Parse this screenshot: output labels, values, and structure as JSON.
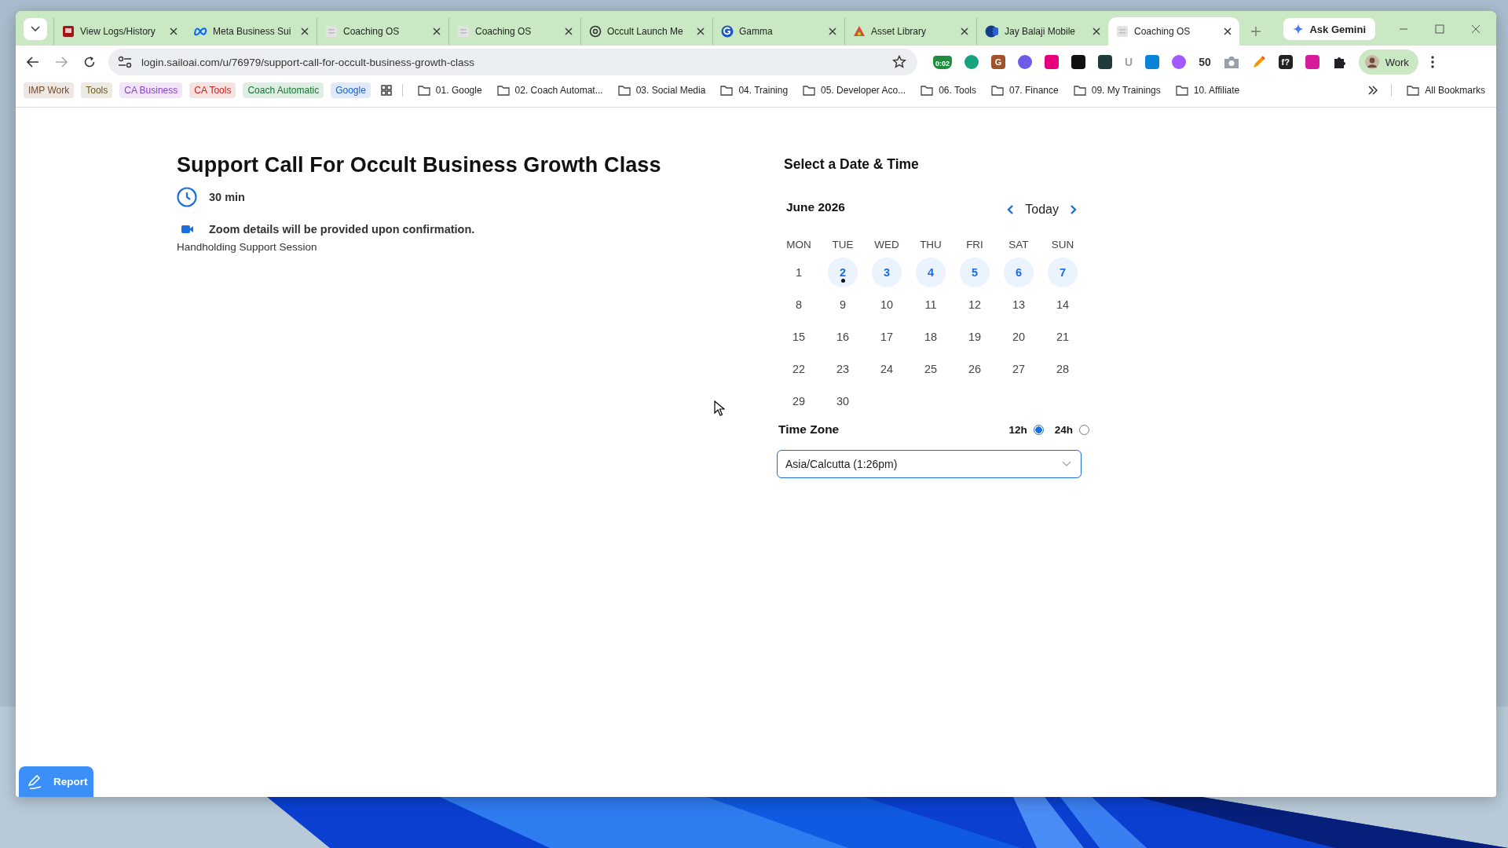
{
  "browser": {
    "tabs": [
      {
        "title": "View Logs/History",
        "kind": "log",
        "selected": false
      },
      {
        "title": "Meta Business Sui",
        "kind": "meta",
        "selected": false
      },
      {
        "title": "Coaching OS",
        "kind": "page",
        "selected": false
      },
      {
        "title": "Coaching OS",
        "kind": "page",
        "selected": false
      },
      {
        "title": "Occult Launch Me",
        "kind": "knot",
        "selected": false
      },
      {
        "title": "Gamma",
        "kind": "gamma",
        "selected": false
      },
      {
        "title": "Asset Library",
        "kind": "asset",
        "selected": false
      },
      {
        "title": "Jay Balaji Mobile",
        "kind": "jb",
        "selected": false
      },
      {
        "title": "Coaching OS",
        "kind": "page",
        "selected": true
      }
    ],
    "gemini": "Ask Gemini",
    "url": "login.sailoai.com/u/76979/support-call-for-occult-business-growth-class",
    "extensions": [
      {
        "kind": "badge",
        "color": "#1e8e3e",
        "text": "0:02"
      },
      {
        "kind": "circle",
        "color": "#15a37f"
      },
      {
        "kind": "square",
        "color": "#a0522d",
        "text": "G"
      },
      {
        "kind": "circle",
        "color": "#6c5ce7"
      },
      {
        "kind": "square",
        "color": "#e6007e"
      },
      {
        "kind": "square",
        "color": "#111111"
      },
      {
        "kind": "square",
        "color": "#1f3b3b"
      },
      {
        "kind": "glyph",
        "color": "#9aa0a6",
        "text": "U"
      },
      {
        "kind": "square",
        "color": "#0a84d8"
      },
      {
        "kind": "circle",
        "color": "#a259ff"
      },
      {
        "kind": "glyph",
        "color": "#333333",
        "text": "50"
      },
      {
        "kind": "camera",
        "color": "#9aa0a6"
      },
      {
        "kind": "pen",
        "color": "#f29900"
      },
      {
        "kind": "square",
        "color": "#222222",
        "text": "f?"
      },
      {
        "kind": "square",
        "color": "#d81b9b"
      },
      {
        "kind": "puzzle",
        "color": "#202124"
      }
    ],
    "profile": "Work",
    "bookmark_chips": [
      {
        "label": "IMP Work",
        "color": "#7a4a2a"
      },
      {
        "label": "Tools",
        "color": "#6b5a1e"
      },
      {
        "label": "CA Business",
        "color": "#8a3ec8"
      },
      {
        "label": "CA Tools",
        "color": "#c5221f"
      },
      {
        "label": "Coach Automatic",
        "color": "#137333"
      },
      {
        "label": "Google",
        "color": "#1a5fd0"
      }
    ],
    "bookmark_folders": [
      "01. Google",
      "02. Coach Automat...",
      "03. Social Media",
      "04. Training",
      "05. Developer Aco...",
      "06. Tools",
      "07. Finance",
      "09. My Trainings",
      "10. Affiliate"
    ],
    "all_bookmarks": "All Bookmarks"
  },
  "event": {
    "title": "Support Call For Occult Business Growth Class",
    "duration": "30 min",
    "location": "Zoom details will be provided upon confirmation.",
    "description": "Handholding Support Session"
  },
  "calendar": {
    "heading": "Select a Date & Time",
    "month": "June 2026",
    "today_label": "Today",
    "weekdays": [
      "MON",
      "TUE",
      "WED",
      "THU",
      "FRI",
      "SAT",
      "SUN"
    ],
    "days": [
      {
        "label": "1",
        "available": false,
        "today": false
      },
      {
        "label": "2",
        "available": true,
        "today": true
      },
      {
        "label": "3",
        "available": true,
        "today": false
      },
      {
        "label": "4",
        "available": true,
        "today": false
      },
      {
        "label": "5",
        "available": true,
        "today": false
      },
      {
        "label": "6",
        "available": true,
        "today": false
      },
      {
        "label": "7",
        "available": true,
        "today": false
      },
      {
        "label": "8",
        "available": false,
        "today": false
      },
      {
        "label": "9",
        "available": false,
        "today": false
      },
      {
        "label": "10",
        "available": false,
        "today": false
      },
      {
        "label": "11",
        "available": false,
        "today": false
      },
      {
        "label": "12",
        "available": false,
        "today": false
      },
      {
        "label": "13",
        "available": false,
        "today": false
      },
      {
        "label": "14",
        "available": false,
        "today": false
      },
      {
        "label": "15",
        "available": false,
        "today": false
      },
      {
        "label": "16",
        "available": false,
        "today": false
      },
      {
        "label": "17",
        "available": false,
        "today": false
      },
      {
        "label": "18",
        "available": false,
        "today": false
      },
      {
        "label": "19",
        "available": false,
        "today": false
      },
      {
        "label": "20",
        "available": false,
        "today": false
      },
      {
        "label": "21",
        "available": false,
        "today": false
      },
      {
        "label": "22",
        "available": false,
        "today": false
      },
      {
        "label": "23",
        "available": false,
        "today": false
      },
      {
        "label": "24",
        "available": false,
        "today": false
      },
      {
        "label": "25",
        "available": false,
        "today": false
      },
      {
        "label": "26",
        "available": false,
        "today": false
      },
      {
        "label": "27",
        "available": false,
        "today": false
      },
      {
        "label": "28",
        "available": false,
        "today": false
      },
      {
        "label": "29",
        "available": false,
        "today": false
      },
      {
        "label": "30",
        "available": false,
        "today": false
      }
    ],
    "timezone_label": "Time Zone",
    "formats": [
      {
        "label": "12h",
        "selected": true
      },
      {
        "label": "24h",
        "selected": false
      }
    ],
    "timezone": "Asia/Calcutta (1:26pm)"
  },
  "report": "Report"
}
